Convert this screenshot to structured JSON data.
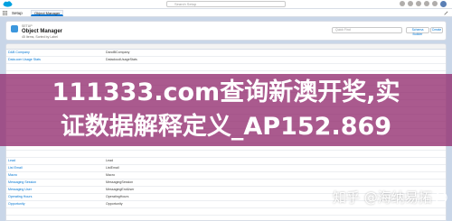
{
  "topbar": {
    "search_placeholder": "Search Setup"
  },
  "nav": {
    "setup_label": "Setup",
    "active_tab": "Object Manager"
  },
  "header": {
    "breadcrumb": "SETUP",
    "title": "Object Manager",
    "subtitle": "45 Items, Sorted by Label",
    "quick_find_placeholder": "Quick Find",
    "schema_builder_label": "Schema Builder",
    "create_label": "Create"
  },
  "table": {
    "rows": [
      {
        "label": "D&B Company",
        "api": "DandBCompany"
      },
      {
        "label": "Data.com Usage Stats",
        "api": "DatacloudUsageStats"
      },
      {
        "label": "",
        "api": ""
      },
      {
        "label": "",
        "api": ""
      },
      {
        "label": "",
        "api": ""
      },
      {
        "label": "",
        "api": ""
      },
      {
        "label": "",
        "api": ""
      },
      {
        "label": "",
        "api": ""
      },
      {
        "label": "",
        "api": ""
      },
      {
        "label": "",
        "api": ""
      },
      {
        "label": "",
        "api": ""
      },
      {
        "label": "",
        "api": ""
      },
      {
        "label": "",
        "api": ""
      },
      {
        "label": "",
        "api": ""
      },
      {
        "label": "",
        "api": ""
      },
      {
        "label": "Lead",
        "api": "Lead"
      },
      {
        "label": "List Email",
        "api": "ListEmail"
      },
      {
        "label": "Macro",
        "api": "Macro"
      },
      {
        "label": "Messaging Session",
        "api": "MessagingSession"
      },
      {
        "label": "Messaging User",
        "api": "MessagingEndUser"
      },
      {
        "label": "Operating Hours",
        "api": "OperatingHours"
      },
      {
        "label": "Opportunity",
        "api": "Opportunity"
      },
      {
        "label": "",
        "api": ""
      },
      {
        "label": "",
        "api": ""
      },
      {
        "label": "",
        "api": ""
      }
    ]
  },
  "overlay": {
    "line1": "111333.com查询新澳开奖,实",
    "line2": "证数据解释定义_AP152.869"
  },
  "watermark": {
    "text": "知乎 @海纳易拓"
  },
  "colors": {
    "overlay": "#922c6e",
    "accent": "#0176d3",
    "backdrop": "#c9d6e8"
  }
}
